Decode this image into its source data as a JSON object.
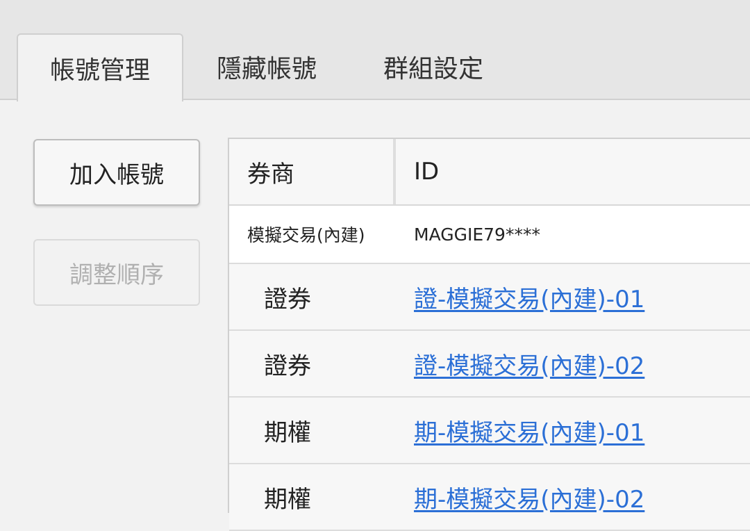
{
  "tabs": [
    {
      "label": "帳號管理",
      "active": true
    },
    {
      "label": "隱藏帳號",
      "active": false
    },
    {
      "label": "群組設定",
      "active": false
    }
  ],
  "sidebar": {
    "add_account": "加入帳號",
    "reorder": "調整順序"
  },
  "table": {
    "headers": {
      "broker": "券商",
      "id": "ID"
    },
    "parent_row": {
      "broker": "模擬交易(內建)",
      "id": "MAGGIE79****"
    },
    "rows": [
      {
        "broker": "證券",
        "account": "證-模擬交易(內建)-01"
      },
      {
        "broker": "證券",
        "account": "證-模擬交易(內建)-02"
      },
      {
        "broker": "期權",
        "account": "期-模擬交易(內建)-01"
      },
      {
        "broker": "期權",
        "account": "期-模擬交易(內建)-02"
      }
    ]
  },
  "colors": {
    "link": "#2b6fd6",
    "disabled_text": "#b0b0b0"
  }
}
